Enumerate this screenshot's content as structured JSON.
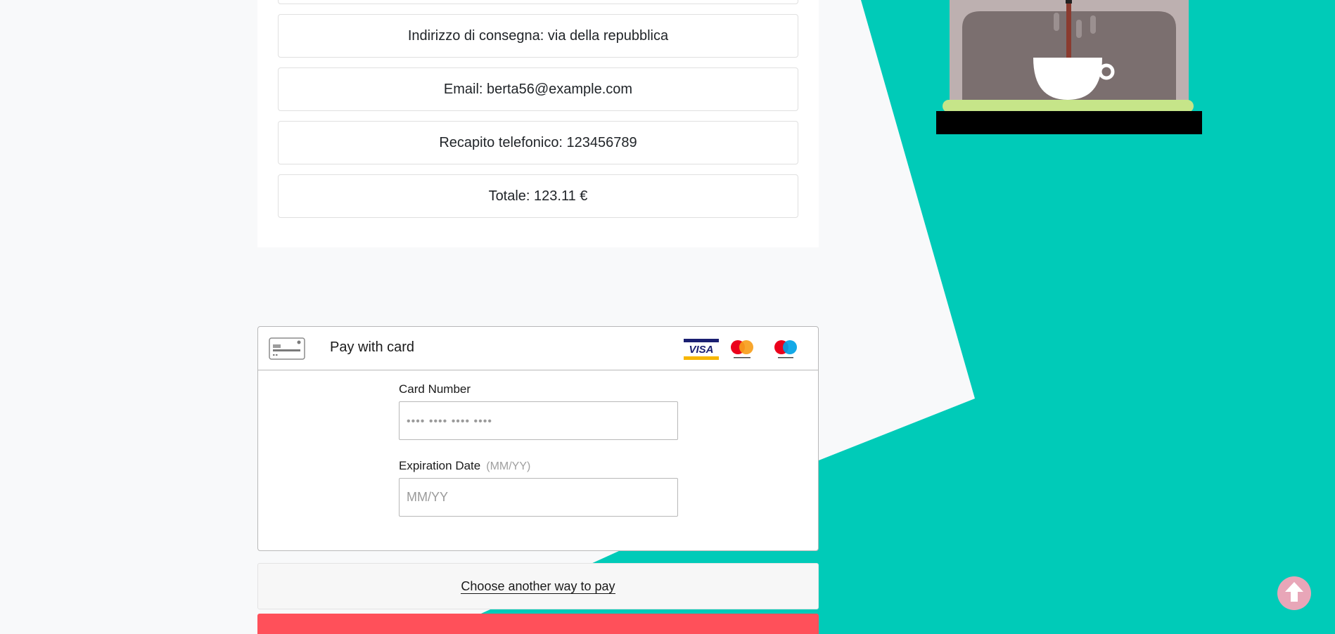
{
  "order_summary": {
    "address": "Indirizzo di consegna: via della repubblica",
    "email": "Email: berta56@example.com",
    "phone": "Recapito telefonico: 123456789",
    "total": "Totale: 123.11 €"
  },
  "payment": {
    "title": "Pay with card",
    "brands": [
      "visa-logo",
      "mastercard-logo",
      "maestro-logo"
    ],
    "card_number_label": "Card Number",
    "card_number_placeholder": "•••• •••• •••• ••••",
    "card_number_value": "",
    "expiration_label": "Expiration Date",
    "expiration_hint": "(MM/YY)",
    "expiration_placeholder": "MM/YY",
    "expiration_value": ""
  },
  "alternative": {
    "link_label": "Choose another way to pay"
  },
  "colors": {
    "accent_teal": "#00cbb8",
    "pay_button_red": "#ff505a",
    "scroll_top_pink": "#e8a6b8"
  },
  "icons": {
    "card": "credit-card-icon",
    "scroll_top": "arrow-up-icon",
    "illustration": "coffee-machine-illustration"
  }
}
